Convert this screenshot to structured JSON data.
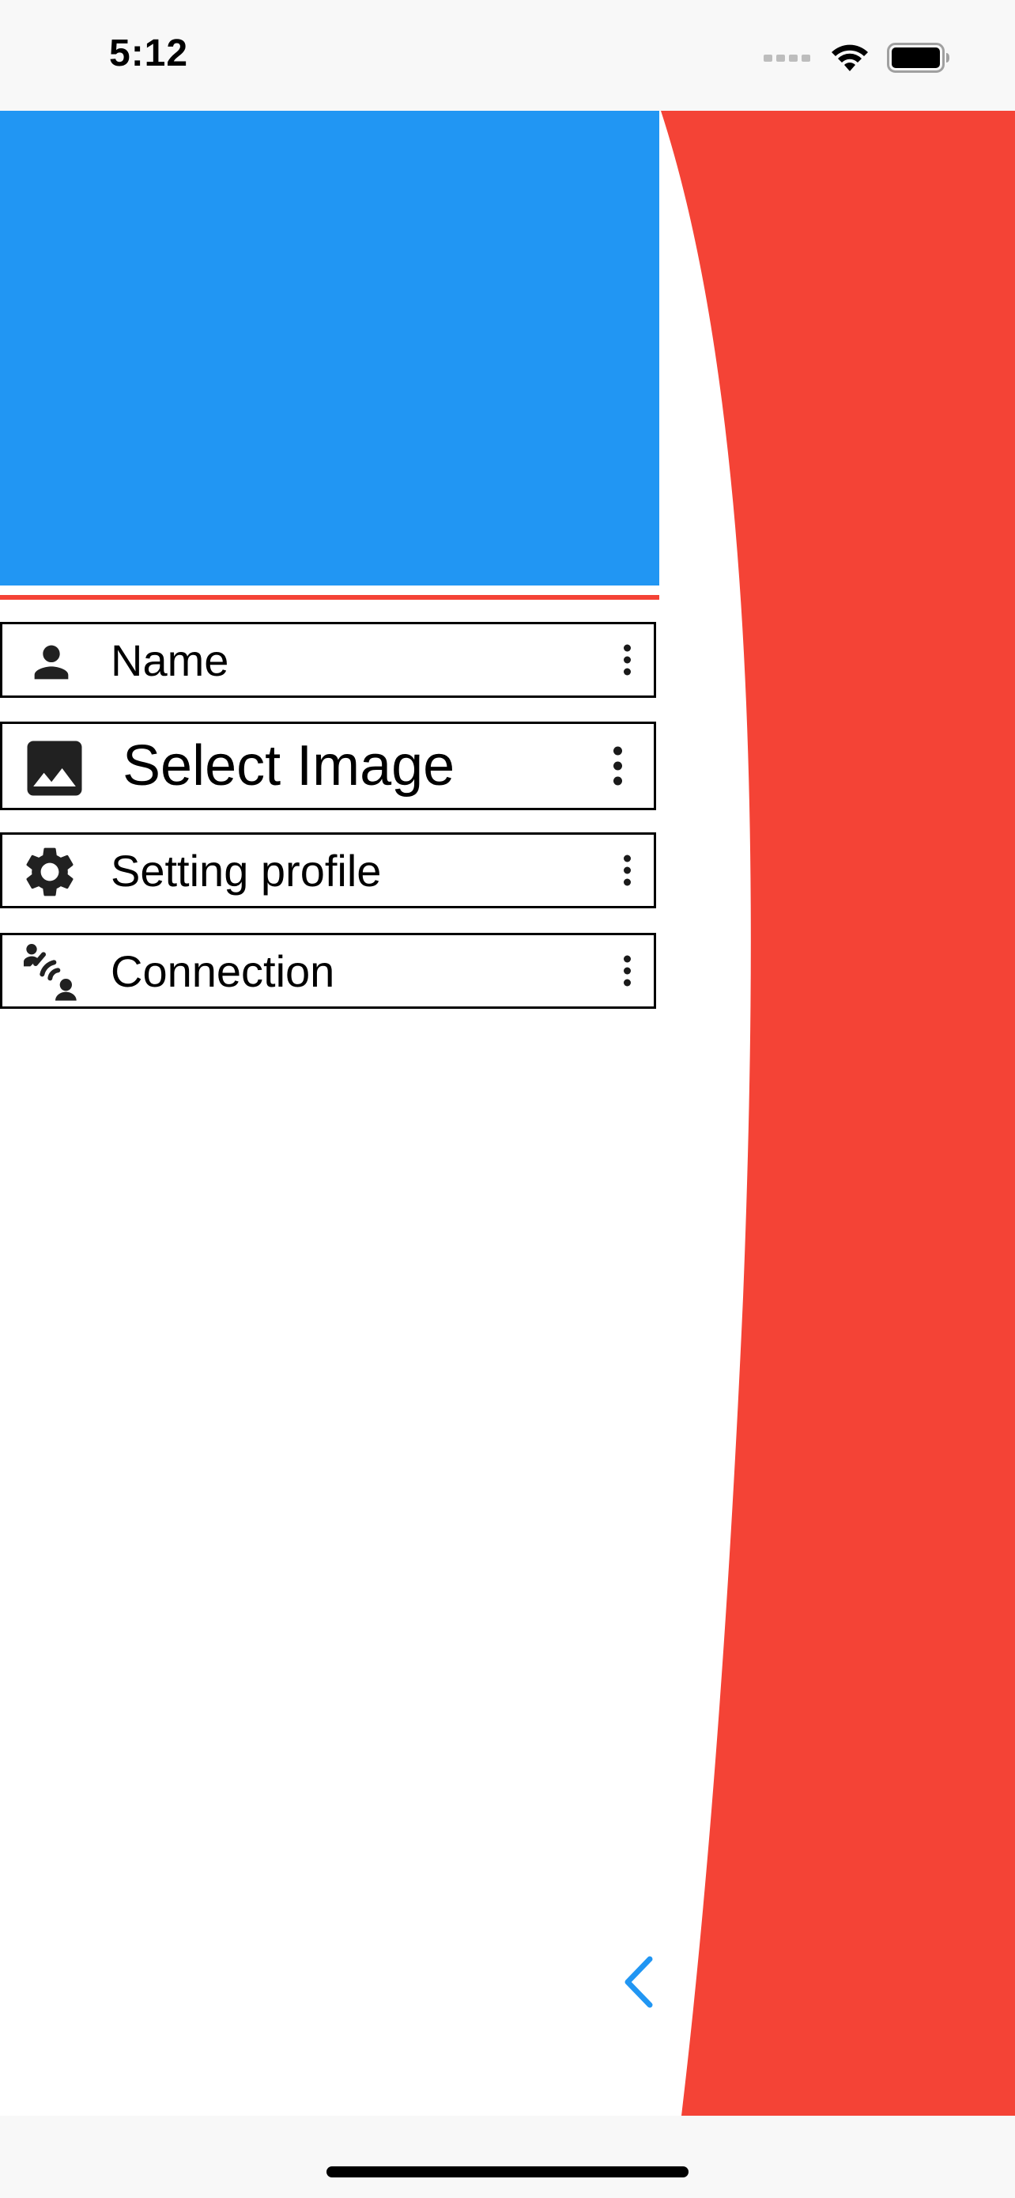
{
  "status_bar": {
    "time": "5:12",
    "icons": [
      "signal-dots-icon",
      "wifi-icon",
      "battery-icon"
    ]
  },
  "colors": {
    "header_blue": "#2196f3",
    "accent_red": "#f44336",
    "chevron_blue": "#2196f3"
  },
  "drawer": {
    "items": [
      {
        "label": "Name",
        "icon": "person-icon"
      },
      {
        "label": "Select Image",
        "icon": "image-icon"
      },
      {
        "label": "Setting profile",
        "icon": "gear-icon"
      },
      {
        "label": "Connection",
        "icon": "connection-icon"
      }
    ]
  },
  "navigation": {
    "back_icon": "chevron-left-icon"
  }
}
